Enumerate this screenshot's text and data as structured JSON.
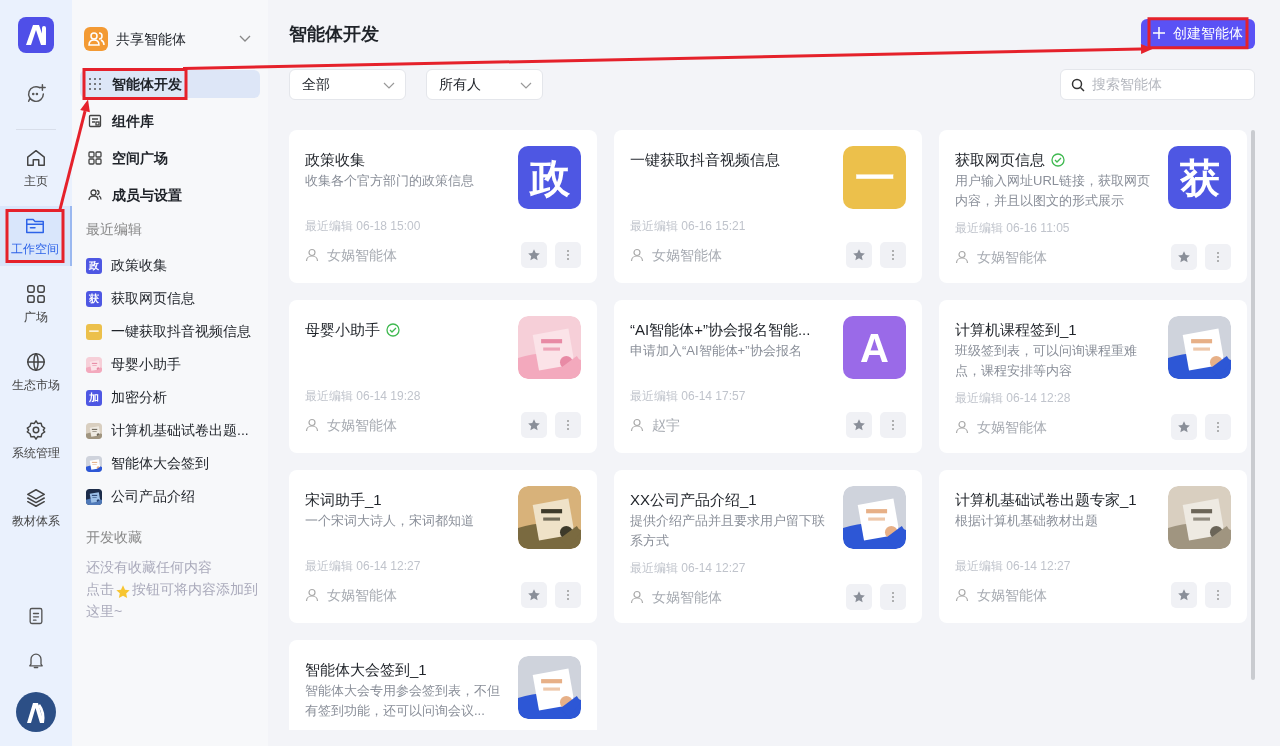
{
  "rail": {
    "items": [
      {
        "label": "主页",
        "selected": false,
        "highlighted": false
      },
      {
        "label": "工作空间",
        "selected": true,
        "highlighted": true
      },
      {
        "label": "广场",
        "selected": false,
        "highlighted": false
      },
      {
        "label": "生态市场",
        "selected": false,
        "highlighted": false
      },
      {
        "label": "系统管理",
        "selected": false,
        "highlighted": false
      },
      {
        "label": "教材体系",
        "selected": false,
        "highlighted": false
      }
    ]
  },
  "sidebar": {
    "space": "共享智能体",
    "nav": [
      {
        "label": "智能体开发",
        "selected": true,
        "highlighted": true
      },
      {
        "label": "组件库",
        "selected": false,
        "highlighted": false
      },
      {
        "label": "空间广场",
        "selected": false,
        "highlighted": false
      },
      {
        "label": "成员与设置",
        "selected": false,
        "highlighted": false
      }
    ],
    "recent_title": "最近编辑",
    "recent": [
      {
        "label": "政策收集",
        "thumb": {
          "kind": "letter",
          "text": "政",
          "color": "#4e57e3"
        }
      },
      {
        "label": "获取网页信息",
        "thumb": {
          "kind": "letter",
          "text": "获",
          "color": "#4e57e3"
        }
      },
      {
        "label": "一键获取抖音视频信息",
        "thumb": {
          "kind": "letter",
          "text": "一",
          "color": "#ecc04b"
        }
      },
      {
        "label": "母婴小助手"
      },
      {
        "label": "加密分析",
        "thumb": {
          "kind": "letter",
          "text": "加",
          "color": "#4e57e3"
        }
      },
      {
        "label": "计算机基础试卷出题..."
      },
      {
        "label": "智能体大会签到"
      },
      {
        "label": "公司产品介绍"
      }
    ],
    "favorites_title": "开发收藏",
    "favorites_empty": "还没有收藏任何内容",
    "favorites_hint_before": "点击",
    "favorites_hint_after": "按钮可将内容添加到这里~"
  },
  "main": {
    "title": "智能体开发",
    "create_button": {
      "label": "创建智能体",
      "highlighted": true
    },
    "filters": [
      "全部",
      "所有人"
    ],
    "search": {
      "placeholder": "搜索智能体"
    },
    "cards": [
      {
        "title": "政策收集",
        "verified": false,
        "desc": "收集各个官方部门的政策信息",
        "thumb": {
          "kind": "letter",
          "text": "政",
          "color": "#4e57e3"
        },
        "edited": "最近编辑 06-18 15:00",
        "author": "女娲智能体"
      },
      {
        "title": "一键获取抖音视频信息",
        "verified": false,
        "thumb": {
          "kind": "letter",
          "text": "一",
          "color": "#ecc04b"
        },
        "edited": "最近编辑 06-16 15:21",
        "author": "女娲智能体"
      },
      {
        "title": "获取网页信息",
        "verified": true,
        "desc": "用户输入网址URL链接，获取网页内容，并且以图文的形式展示",
        "thumb": {
          "kind": "letter",
          "text": "获",
          "color": "#4e57e3"
        },
        "edited": "最近编辑 06-16 11:05",
        "author": "女娲智能体"
      },
      {
        "title": "母婴小助手",
        "verified": true,
        "edited": "最近编辑 06-14 19:28",
        "author": "女娲智能体"
      },
      {
        "title": "“AI智能体+”协会报名智能...",
        "verified": false,
        "desc": "申请加入“AI智能体+”协会报名",
        "thumb": {
          "kind": "letter",
          "text": "A",
          "color": "#9a6ae8"
        },
        "edited": "最近编辑 06-14 17:57",
        "author": "赵宇"
      },
      {
        "title": "计算机课程签到_1",
        "verified": false,
        "desc": "班级签到表，可以问询课程重难点，课程安排等内容",
        "edited": "最近编辑 06-14 12:28",
        "author": "女娲智能体"
      },
      {
        "title": "宋词助手_1",
        "verified": false,
        "desc": "一个宋词大诗人，宋词都知道",
        "edited": "最近编辑 06-14 12:27",
        "author": "女娲智能体"
      },
      {
        "title": "XX公司产品介绍_1",
        "verified": false,
        "desc": "提供介绍产品并且要求用户留下联系方式",
        "edited": "最近编辑 06-14 12:27",
        "author": "女娲智能体"
      },
      {
        "title": "计算机基础试卷出题专家_1",
        "verified": false,
        "desc": "根据计算机基础教材出题",
        "edited": "最近编辑 06-14 12:27",
        "author": "女娲智能体"
      },
      {
        "title": "智能体大会签到_1",
        "verified": false,
        "desc": "智能体大会专用参会签到表，不但有签到功能，还可以问询会议..."
      }
    ]
  },
  "annotation": {
    "connect_highlights": true
  }
}
